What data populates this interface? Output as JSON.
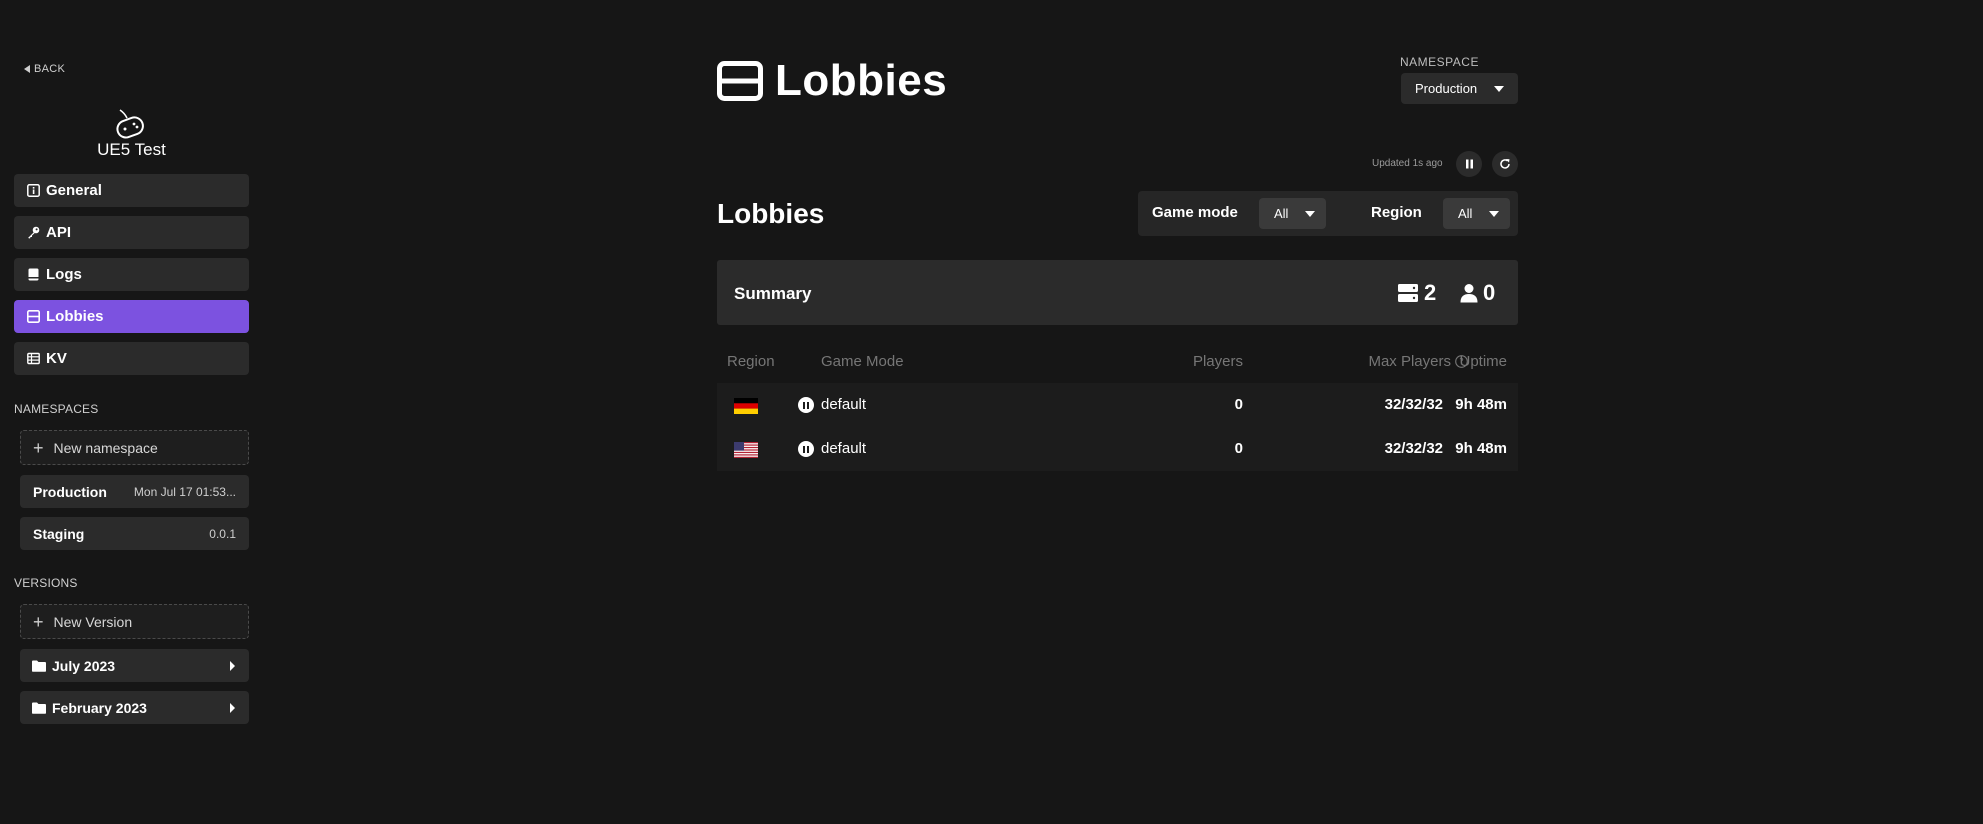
{
  "sidebar": {
    "back_label": "BACK",
    "game_title": "UE5 Test",
    "nav": [
      {
        "label": "General",
        "icon": "info-icon"
      },
      {
        "label": "API",
        "icon": "key-icon"
      },
      {
        "label": "Logs",
        "icon": "book-icon"
      },
      {
        "label": "Lobbies",
        "icon": "lobbies-icon",
        "active": true
      },
      {
        "label": "KV",
        "icon": "table-icon"
      }
    ],
    "namespaces_label": "NAMESPACES",
    "new_namespace_label": "New namespace",
    "namespaces": [
      {
        "name": "Production",
        "meta": "Mon Jul 17 01:53..."
      },
      {
        "name": "Staging",
        "meta": "0.0.1"
      }
    ],
    "versions_label": "VERSIONS",
    "new_version_label": "New Version",
    "version_groups": [
      {
        "label": "July 2023"
      },
      {
        "label": "February 2023"
      }
    ]
  },
  "header": {
    "title": "Lobbies",
    "namespace_label": "NAMESPACE",
    "namespace_value": "Production"
  },
  "status": {
    "updated_text": "Updated 1s ago"
  },
  "main": {
    "section_title": "Lobbies",
    "filters": {
      "game_mode_label": "Game mode",
      "game_mode_value": "All",
      "region_label": "Region",
      "region_value": "All"
    },
    "summary": {
      "title": "Summary",
      "lobby_count": "2",
      "player_count": "0"
    },
    "table": {
      "columns": [
        "Region",
        "Game Mode",
        "Players",
        "Max Players",
        "Uptime"
      ],
      "rows": [
        {
          "region_flag": "germany-flag-icon",
          "game_mode": "default",
          "players": "0",
          "max_players": "32/32/32",
          "uptime": "9h 48m"
        },
        {
          "region_flag": "usa-flag-icon",
          "game_mode": "default",
          "players": "0",
          "max_players": "32/32/32",
          "uptime": "9h 48m"
        }
      ]
    }
  },
  "colors": {
    "background": "#161616",
    "panel": "#2b2b2b",
    "accent": "#7c52e0"
  }
}
